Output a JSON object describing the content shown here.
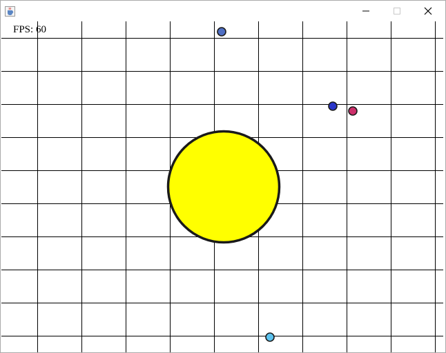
{
  "window": {
    "app_icon": "java-cup-icon",
    "controls": [
      {
        "name": "minimize-button",
        "icon": "minimize-icon"
      },
      {
        "name": "maximize-button",
        "icon": "maximize-icon",
        "disabled": true
      },
      {
        "name": "close-button",
        "icon": "close-icon"
      }
    ]
  },
  "hud": {
    "fps_label": "FPS: 60"
  },
  "scene": {
    "background": "#ffffff",
    "grid_color": "#000000",
    "sun": {
      "fill": "#ffff00",
      "stroke": "#1a1a1a"
    },
    "bodies": [
      {
        "name": "planet-blue-top",
        "fill": "#4f6fc4"
      },
      {
        "name": "planet-dark-blue",
        "fill": "#2a35c8"
      },
      {
        "name": "planet-magenta",
        "fill": "#cc2f6a"
      },
      {
        "name": "planet-light-blue",
        "fill": "#5cc2ee"
      }
    ]
  }
}
